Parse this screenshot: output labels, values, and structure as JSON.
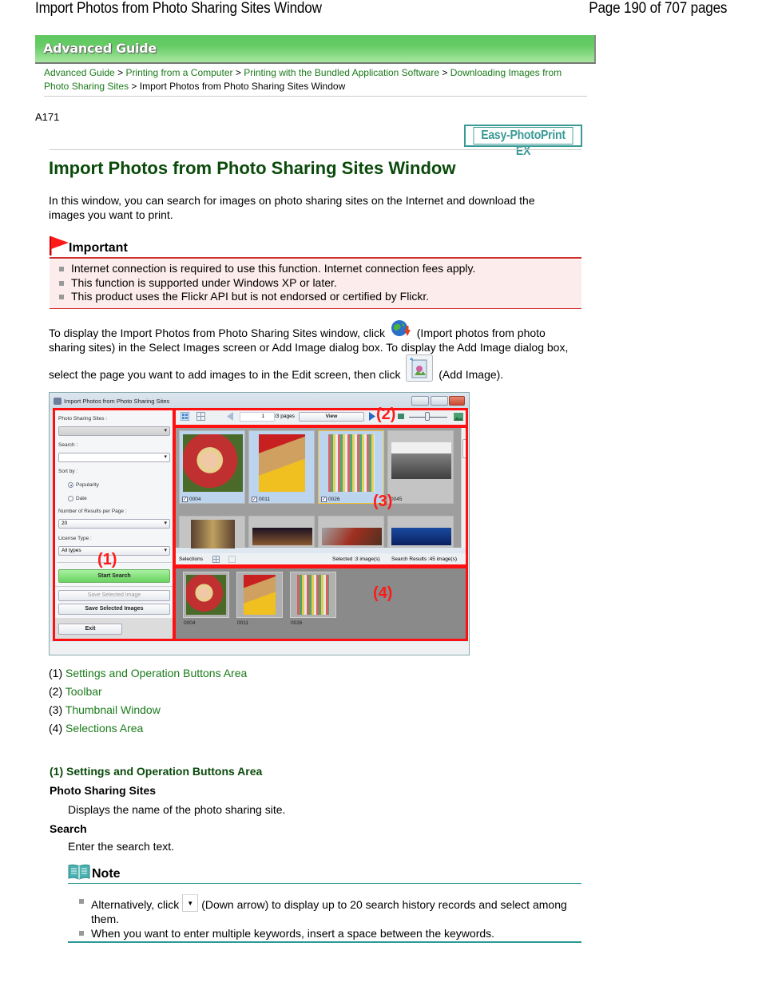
{
  "header": {
    "doc_title": "Import Photos from Photo Sharing Sites Window",
    "page_indicator": "Page 190 of 707 pages"
  },
  "banner": {
    "label": "Advanced Guide"
  },
  "breadcrumb": {
    "items": [
      {
        "label": "Advanced Guide",
        "link": true
      },
      {
        "label": "Printing from a Computer",
        "link": true
      },
      {
        "label": "Printing with the Bundled Application Software",
        "link": true
      },
      {
        "label": "Downloading Images from Photo Sharing Sites",
        "link": true
      },
      {
        "label": "Import Photos from Photo Sharing Sites Window",
        "link": false
      }
    ],
    "separator": ">"
  },
  "doc_code": "A171",
  "product_badge": "Easy-PhotoPrint EX",
  "page_title": "Import Photos from Photo Sharing Sites Window",
  "intro": "In this window, you can search for images on photo sharing sites on the Internet and download the images you want to print.",
  "important": {
    "heading": "Important",
    "items": [
      "Internet connection is required to use this function. Internet connection fees apply.",
      "This function is supported under Windows XP or later.",
      "This product uses the Flickr API but is not endorsed or certified by Flickr."
    ]
  },
  "display_instructions": {
    "part1": "To display the Import Photos from Photo Sharing Sites window, click",
    "part2": "(Import photos from photo sharing sites) in the Select Images screen or Add Image dialog box. To display the Add Image dialog box, select the page you want to add images to in the Edit screen, then click",
    "part3": "(Add Image).",
    "icon1": "globe-import-icon",
    "icon2": "add-image-icon"
  },
  "screenshot": {
    "window_title": "Import Photos from Photo Sharing Sites",
    "left_panel": {
      "photo_sharing_sites_label": "Photo Sharing Sites :",
      "search_label": "Search :",
      "sort_by_label": "Sort by :",
      "sort_options": [
        "Popularity",
        "Date"
      ],
      "sort_selected": "Popularity",
      "results_per_page_label": "Number of Results per Page :",
      "results_per_page_value": "20",
      "license_type_label": "License Type :",
      "license_type_value": "All types",
      "start_search": "Start Search",
      "save_selected_image": "Save Selected Image",
      "save_selected_images": "Save Selected Images",
      "exit": "Exit"
    },
    "toolbar": {
      "page_value": "1",
      "page_total": "/3 pages",
      "view_button": "View"
    },
    "thumbnails": [
      {
        "id": "0004",
        "checked": true,
        "selected": true
      },
      {
        "id": "0011",
        "checked": true,
        "selected": true
      },
      {
        "id": "0026",
        "checked": true,
        "selected": true
      },
      {
        "id": "0045",
        "checked": false,
        "selected": false
      }
    ],
    "status_bar": {
      "selections_label": "Selections",
      "selected_count": "Selected :3 image(s)",
      "search_results": "Search Results :45 image(s)"
    },
    "selections": [
      "0004",
      "0011",
      "0026"
    ],
    "markers": [
      "(1)",
      "(2)",
      "(3)",
      "(4)"
    ]
  },
  "legend": [
    {
      "num": "(1)",
      "label": "Settings and Operation Buttons Area"
    },
    {
      "num": "(2)",
      "label": "Toolbar"
    },
    {
      "num": "(3)",
      "label": "Thumbnail Window"
    },
    {
      "num": "(4)",
      "label": "Selections Area"
    }
  ],
  "section1": {
    "heading": "(1) Settings and Operation Buttons Area",
    "terms": [
      {
        "term": "Photo Sharing Sites",
        "desc": "Displays the name of the photo sharing site."
      },
      {
        "term": "Search",
        "desc": "Enter the search text."
      }
    ]
  },
  "note": {
    "heading": "Note",
    "item1_pre": "Alternatively, click",
    "item1_post": "(Down arrow) to display up to 20 search history records and select among them.",
    "item2": "When you want to enter multiple keywords, insert a space between the keywords."
  },
  "colors": {
    "link_green": "#1a7a1a",
    "title_green": "#0a4a0a",
    "important_red": "#d03030",
    "note_teal": "#2a9a96",
    "marker_red": "#ff1a1a"
  }
}
